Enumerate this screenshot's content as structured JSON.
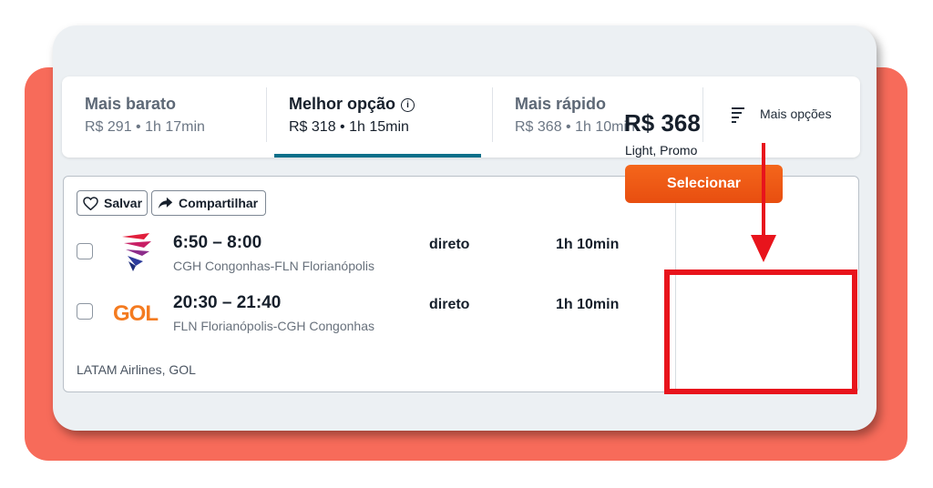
{
  "sort_tabs": [
    {
      "title": "Mais barato",
      "subtitle": "R$ 291 • 1h 17min",
      "active": false
    },
    {
      "title": "Melhor opção",
      "subtitle": "R$ 318 • 1h 15min",
      "active": true
    },
    {
      "title": "Mais rápido",
      "subtitle": "R$ 368 • 1h 10min",
      "active": false
    }
  ],
  "info_icon": "ⓘ",
  "more_options_label": "Mais opções",
  "actions": {
    "save": "Salvar",
    "share": "Compartilhar"
  },
  "legs": [
    {
      "times": "6:50 – 8:00",
      "route": "CGH Congonhas-FLN Florianópolis",
      "stops": "direto",
      "duration": "1h 10min",
      "airline_logo": "latam-logo-icon"
    },
    {
      "times": "20:30 – 21:40",
      "route": "FLN Florianópolis-CGH Congonhas",
      "stops": "direto",
      "duration": "1h 10min",
      "airline_logo": "gol-logo-icon",
      "logo_text": "GOL"
    }
  ],
  "airlines": "LATAM Airlines, GOL",
  "price": {
    "amount": "R$ 368",
    "fare": "Light, Promo",
    "select_label": "Selecionar"
  },
  "colors": {
    "accent_underline": "#0b6f8a",
    "cta": "#f25c15",
    "annotation": "#e8141c",
    "background_coral": "#f76b5a"
  }
}
